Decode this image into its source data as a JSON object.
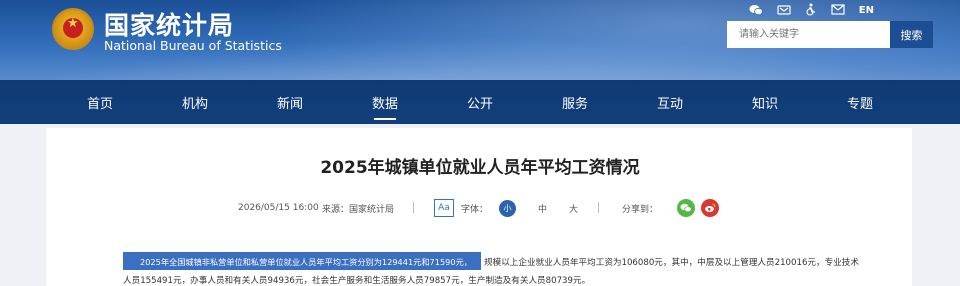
{
  "header": {
    "logo_cn": "国家统计局",
    "logo_en": "National Bureau of Statistics",
    "icons": [
      "wechat-icon",
      "weibo-icon",
      "accessibility-icon",
      "mail-icon"
    ],
    "lang_label": "EN",
    "search_placeholder": "请输入关键字",
    "search_button": "搜索"
  },
  "nav": {
    "items": [
      "首页",
      "机构",
      "新闻",
      "数据",
      "公开",
      "服务",
      "互动",
      "知识",
      "专题"
    ],
    "active": "数据"
  },
  "article": {
    "title": "2025年城镇单位就业人员年平均工资情况",
    "date": "2026/05/15 16:00",
    "source_label": "来源：国家统计局",
    "aa_label": "Aa",
    "font_label": "字体：",
    "font_sizes": [
      "小",
      "中",
      "大"
    ],
    "share_label": "分享到：",
    "para1_highlighted": "2025年全国城镇非私营单位和私营单位就业人员年平均工资分别为129441元和71590元，",
    "para1_rest": "规模以上企业就业人员年平均工资为106080元，其中，中层及以上管理人员210016元，专业技术",
    "para2": "人员155491元，办事人员和有关人员94936元，社会生产服务和生活服务人员79857元，生产制造及有关人员80739元。"
  },
  "colors": {
    "header_blue": "#2d68b4",
    "nav_blue": "#123f7c",
    "highlight_blue": "#3a6fc2"
  }
}
